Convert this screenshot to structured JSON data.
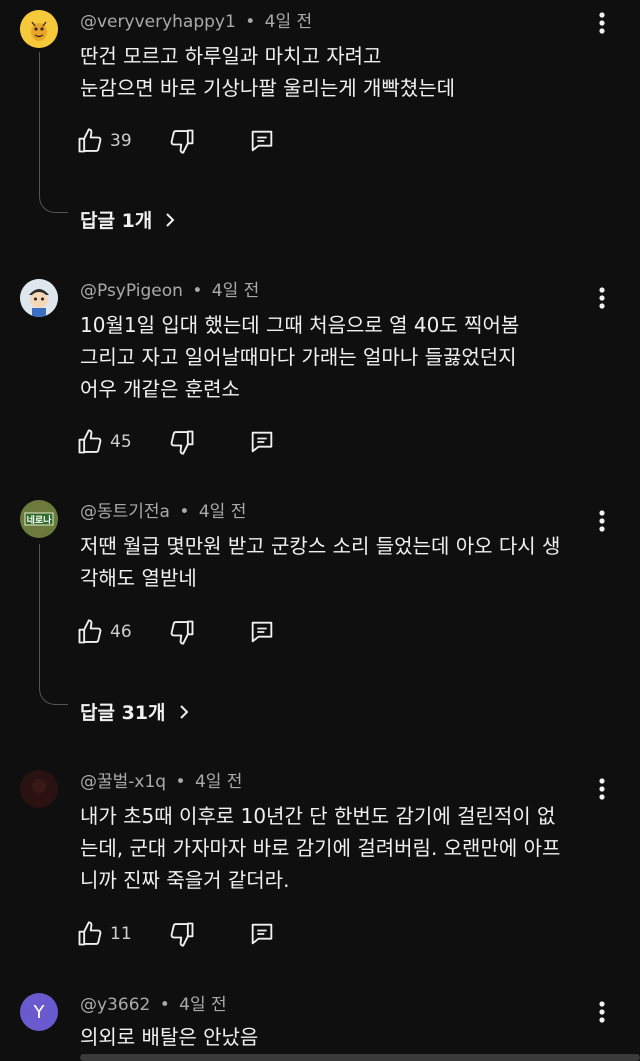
{
  "comments": [
    {
      "user": "@veryveryhappy1",
      "time": "4일 전",
      "text": "딴건 모르고 하루일과 마치고 자려고\n눈감으면 바로 기상나팔 울리는게 개빡쳤는데",
      "likes": "39",
      "replies": "답글 1개"
    },
    {
      "user": "@PsyPigeon",
      "time": "4일 전",
      "text": "10월1일 입대 했는데 그때 처음으로 열 40도 찍어봄\n그리고 자고 일어날때마다 가래는 얼마나 들끓었던지\n어우 개같은 훈련소",
      "likes": "45"
    },
    {
      "user": "@동트기전a",
      "time": "4일 전",
      "text": "저땐 월급 몇만원 받고 군캉스 소리 들었는데 아오 다시 생\n각해도 열받네",
      "likes": "46",
      "replies": "답글 31개",
      "avatar_text": "네로나"
    },
    {
      "user": "@꿀벌-x1q",
      "time": "4일 전",
      "text": "내가 초5때 이후로 10년간 단 한번도 감기에 걸린적이 없\n는데, 군대 가자마자 바로 감기에 걸려버림. 오랜만에 아프\n니까 진짜 죽을거 같더라.",
      "likes": "11"
    },
    {
      "user": "@y3662",
      "time": "4일 전",
      "text": "의외로 배탈은 안났음",
      "avatar_letter": "Y"
    }
  ],
  "separator": "•",
  "icons": {
    "like": "thumbs-up-icon",
    "dislike": "thumbs-down-icon",
    "reply": "comment-icon",
    "more": "more-vert-icon",
    "chevron": "chevron-right-icon"
  }
}
